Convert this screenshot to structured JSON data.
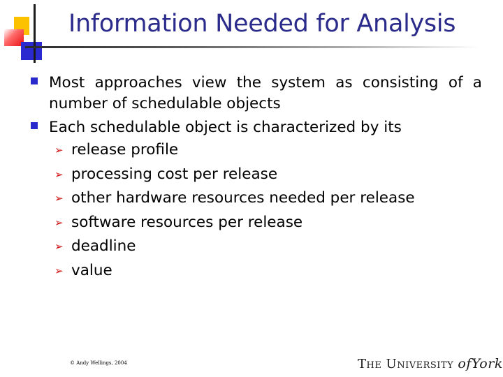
{
  "slide": {
    "title": "Information Needed for Analysis",
    "bullets": [
      {
        "text": "Most approaches view the system as consisting of a number of schedulable objects"
      },
      {
        "text": "Each schedulable object is characterized by its",
        "sub_bullets": [
          "release profile",
          "processing cost per release",
          "other hardware resources needed per release",
          "software resources per release",
          "deadline",
          "value"
        ]
      }
    ],
    "bullet_glyph": "■",
    "sub_bullet_glyph": "➢",
    "footer": "© Andy Wellings, 2004",
    "logo": {
      "prefix": "The University ",
      "of": "of",
      "name": "York"
    },
    "colors": {
      "title": "#2b2b8c",
      "bullet": "#2a2acc",
      "sub_bullet": "#d01010"
    }
  }
}
